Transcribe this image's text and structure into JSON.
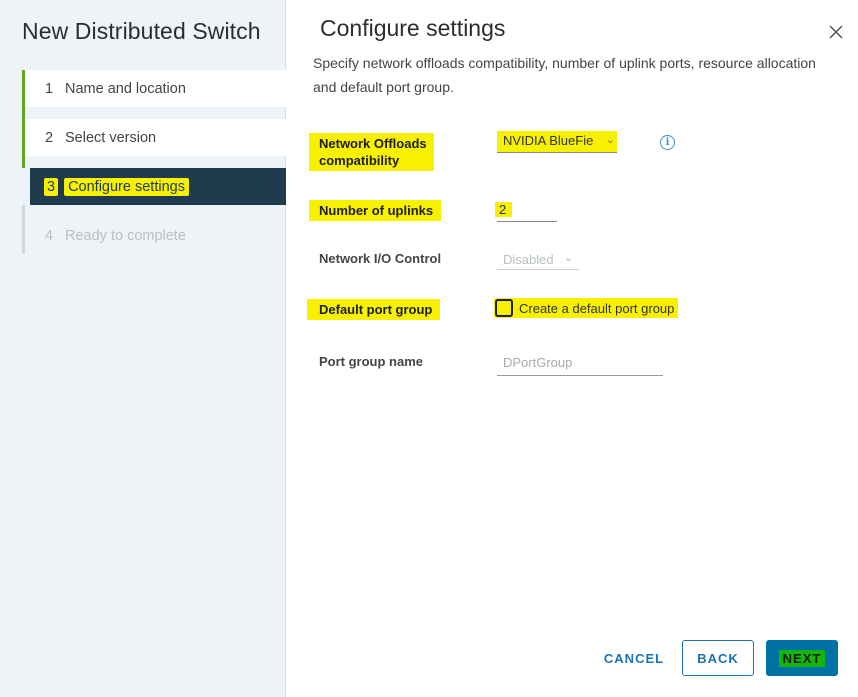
{
  "wizard": {
    "title": "New Distributed Switch",
    "steps": [
      {
        "num": "1",
        "label": "Name and location"
      },
      {
        "num": "2",
        "label": "Select version"
      },
      {
        "num": "3",
        "label": "Configure settings"
      },
      {
        "num": "4",
        "label": "Ready to complete"
      }
    ]
  },
  "main": {
    "title": "Configure settings",
    "description": "Specify network offloads compatibility, number of uplink ports, resource allocation and default port group.",
    "fields": {
      "offloads_label": "Network Offloads compatibility",
      "offloads_value": "NVIDIA BlueFie",
      "uplinks_label": "Number of uplinks",
      "uplinks_value": "2",
      "nioc_label": "Network I/O Control",
      "nioc_value": "Disabled",
      "default_pg_label": "Default port group",
      "default_pg_checkbox_label": "Create a default port group",
      "default_pg_checked": false,
      "pg_name_label": "Port group name",
      "pg_name_placeholder": "DPortGroup"
    }
  },
  "footer": {
    "cancel_label": "CANCEL",
    "back_label": "BACK",
    "next_label": "NEXT"
  },
  "colors": {
    "accent": "#0072a3",
    "highlight": "#f7f000",
    "step_done": "#62a420",
    "active_step_bg": "#1f3b4d"
  },
  "icons": {
    "close": "close-icon",
    "info": "info-icon",
    "chevron": "chevron-down-icon"
  }
}
